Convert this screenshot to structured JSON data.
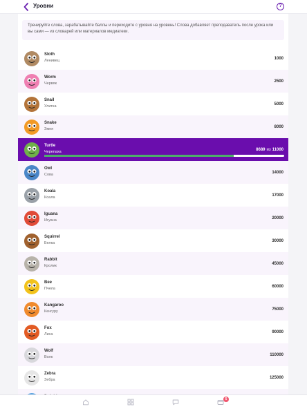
{
  "header": {
    "title": "Уровни",
    "help_icon": "question-icon",
    "back_icon": "chevron-left-icon"
  },
  "intro": "Тренируйте слова, зарабатывайте баллы и переходите с уровня на уровень! Слова добавляет преподаватель после урока или вы сами — из словарей или материалов медиатеки.",
  "levels": [
    {
      "en": "Sloth",
      "ru": "Ленивец",
      "points": "1000",
      "icon": "sloth-icon",
      "color": "#b08a63"
    },
    {
      "en": "Worm",
      "ru": "Червяк",
      "points": "2500",
      "icon": "worm-icon",
      "color": "#ef7fb2"
    },
    {
      "en": "Snail",
      "ru": "Улитка",
      "points": "5000",
      "icon": "snail-icon",
      "color": "#b3743a"
    },
    {
      "en": "Snake",
      "ru": "Змея",
      "points": "8000",
      "icon": "snake-icon",
      "color": "#f29a26"
    },
    {
      "en": "Turtle",
      "ru": "Черепаха",
      "current": "8689",
      "separator": "из",
      "points": "11000",
      "progress": 0.79,
      "icon": "turtle-icon",
      "color": "#6fb04a"
    },
    {
      "en": "Owl",
      "ru": "Сова",
      "points": "14000",
      "icon": "owl-icon",
      "color": "#4a86c7"
    },
    {
      "en": "Koala",
      "ru": "Коала",
      "points": "17000",
      "icon": "koala-icon",
      "color": "#9aa1a8"
    },
    {
      "en": "Iguana",
      "ru": "Игуана",
      "points": "20000",
      "icon": "iguana-icon",
      "color": "#e04b38"
    },
    {
      "en": "Squirrel",
      "ru": "Белка",
      "points": "30000",
      "icon": "squirrel-icon",
      "color": "#a0612e"
    },
    {
      "en": "Rabbit",
      "ru": "Кролик",
      "points": "45000",
      "icon": "rabbit-icon",
      "color": "#b8b3aa"
    },
    {
      "en": "Bee",
      "ru": "Пчела",
      "points": "60000",
      "icon": "bee-icon",
      "color": "#f2c21b"
    },
    {
      "en": "Kangaroo",
      "ru": "Кенгуру",
      "points": "75000",
      "icon": "kangaroo-icon",
      "color": "#f08a2e"
    },
    {
      "en": "Fox",
      "ru": "Лиса",
      "points": "90000",
      "icon": "fox-icon",
      "color": "#e25b24"
    },
    {
      "en": "Wolf",
      "ru": "Волк",
      "points": "110000",
      "icon": "wolf-icon",
      "color": "#d8d8dc"
    },
    {
      "en": "Zebra",
      "ru": "Зебра",
      "points": "125000",
      "icon": "zebra-icon",
      "color": "#e6e6e6"
    },
    {
      "en": "Dolphin",
      "ru": "",
      "points": "",
      "icon": "dolphin-icon",
      "color": "#5aa3e0"
    }
  ],
  "bottom_nav": [
    {
      "icon": "home-icon"
    },
    {
      "icon": "grid-icon"
    },
    {
      "icon": "chat-icon"
    },
    {
      "icon": "wallet-icon",
      "badge": "5"
    }
  ],
  "colors": {
    "accent": "#6a0dad",
    "progress": "#4caf6a",
    "row_tint": "#f9f4fc"
  }
}
